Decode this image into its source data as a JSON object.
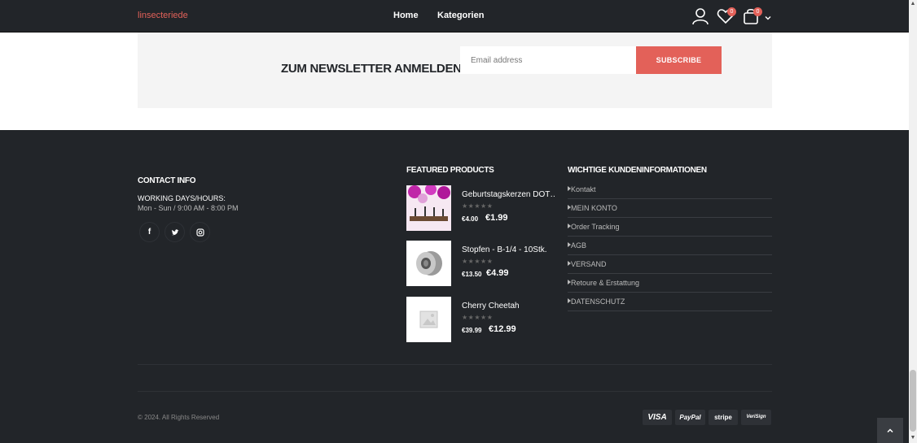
{
  "header": {
    "logo": "linsecteriede",
    "nav": [
      "Home",
      "Kategorien"
    ],
    "wishlist_count": "0",
    "cart_count": "0"
  },
  "newsletter": {
    "title": "ZUM NEWSLETTER ANMELDEN",
    "email_placeholder": "Email address",
    "button": "SUBSCRIBE"
  },
  "contact": {
    "title": "CONTACT INFO",
    "label": "WORKING DAYS/HOURS:",
    "hours": "Mon - Sun / 9:00 AM - 8:00 PM",
    "social": [
      "f",
      "t",
      "i"
    ]
  },
  "featured": {
    "title": "FEATURED PRODUCTS",
    "items": [
      {
        "name": "Geburtstagskerzen DOT…",
        "old_price": "€4.00",
        "new_price": "€1.99"
      },
      {
        "name": "Stopfen - B-1/4 - 10Stk.",
        "old_price": "€13.50",
        "new_price": "€4.99"
      },
      {
        "name": "Cherry Cheetah",
        "old_price": "€39.99",
        "new_price": "€12.99"
      }
    ]
  },
  "info": {
    "title": "WICHTIGE KUNDENINFORMATIONEN",
    "links": [
      "Kontakt",
      "MEIN KONTO",
      "Order Tracking",
      "AGB",
      "VERSAND",
      "Retoure & Erstattung",
      "DATENSCHUTZ"
    ]
  },
  "footer": {
    "copyright": "© 2024. All Rights Reserved",
    "payments": [
      "VISA",
      "PayPal",
      "stripe",
      "VeriSign"
    ]
  },
  "colors": {
    "accent": "#e36159",
    "dark": "#222529"
  }
}
